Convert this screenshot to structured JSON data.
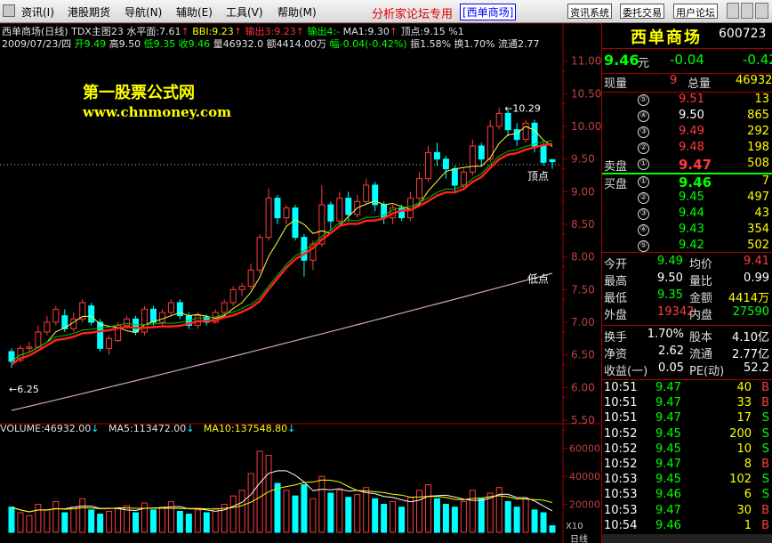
{
  "menubar": {
    "items": [
      "资讯(I)",
      "港股期货",
      "导航(N)",
      "辅助(E)",
      "工具(V)",
      "帮助(M)"
    ],
    "title_text": "分析家论坛专用",
    "title_stock": "[西单商场]",
    "right_buttons": [
      "资讯系统",
      "委托交易",
      "用户论坛"
    ]
  },
  "chart_header": {
    "line1": {
      "name": "西单商场(日线)",
      "indicator": "TDX主图23",
      "level": "水平面:7.61",
      "bbi": "BBI:9.23",
      "out1": "输出3:9.23",
      "out2": "输出4:-",
      "ma1": "MA1:9.30",
      "top": "顶点:9.15",
      "pct": "%1"
    },
    "line2": {
      "date": "2009/07/23/四",
      "open": "开9.49",
      "high": "高9.50",
      "low": "低9.35",
      "close": "收9.46",
      "vol": "量46932.0",
      "amount": "额4414.00万",
      "change": "幅-0.04(-0.42%)",
      "amp": "振1.58%",
      "turnover": "换1.70%",
      "float": "流通2.77"
    }
  },
  "watermark": {
    "line1": "第一股票公式网",
    "line2": "www.chnmoney.com"
  },
  "annotations": {
    "high_label": "10.29",
    "low_label": "6.25",
    "top_point": "顶点",
    "low_point": "低点"
  },
  "volume_header": {
    "vol": "VOLUME:46932.00",
    "ma5": "MA5:113472.00",
    "ma10": "MA10:137548.80"
  },
  "colors": {
    "up": "#ff3c3c",
    "down": "#00ffff",
    "ma_red": "#ff2020",
    "ma_green": "#00c000",
    "ma_long": "#d0a0d0",
    "grid_red": "#a00000"
  },
  "chart_data": {
    "type": "candlestick",
    "title": "西单商场(日线)",
    "ylim": [
      5.5,
      11.2
    ],
    "yticks": [
      "11.00",
      "10.50",
      "10.00",
      "9.50",
      "9.00",
      "8.50",
      "8.00",
      "7.50",
      "7.00",
      "6.50",
      "6.00",
      "5.50"
    ],
    "vol_ylim": [
      0,
      70000
    ],
    "vol_yticks": [
      "60000",
      "40000",
      "20000"
    ],
    "vol_scale": "X10",
    "candles": [
      [
        6.55,
        6.4,
        6.6,
        6.3
      ],
      [
        6.42,
        6.6,
        6.65,
        6.38
      ],
      [
        6.6,
        6.62,
        6.7,
        6.55
      ],
      [
        6.62,
        6.85,
        6.95,
        6.6
      ],
      [
        6.85,
        7.0,
        7.1,
        6.8
      ],
      [
        7.0,
        7.2,
        7.25,
        6.95
      ],
      [
        7.1,
        6.9,
        7.2,
        6.85
      ],
      [
        6.9,
        7.05,
        7.15,
        6.85
      ],
      [
        7.05,
        7.3,
        7.35,
        7.0
      ],
      [
        7.25,
        7.0,
        7.3,
        6.95
      ],
      [
        7.0,
        6.6,
        7.05,
        6.55
      ],
      [
        6.6,
        6.75,
        6.8,
        6.5
      ],
      [
        6.72,
        6.95,
        7.0,
        6.7
      ],
      [
        6.95,
        7.05,
        7.1,
        6.9
      ],
      [
        7.05,
        6.85,
        7.1,
        6.8
      ],
      [
        6.85,
        7.2,
        7.25,
        6.8
      ],
      [
        7.2,
        7.0,
        7.25,
        6.95
      ],
      [
        7.0,
        7.15,
        7.2,
        6.95
      ],
      [
        7.15,
        7.3,
        7.35,
        7.1
      ],
      [
        7.3,
        7.1,
        7.35,
        7.05
      ],
      [
        7.1,
        6.95,
        7.15,
        6.9
      ],
      [
        6.95,
        7.1,
        7.15,
        6.9
      ],
      [
        7.08,
        7.0,
        7.12,
        6.95
      ],
      [
        7.0,
        7.15,
        7.2,
        6.98
      ],
      [
        7.15,
        7.3,
        7.35,
        7.1
      ],
      [
        7.3,
        7.5,
        7.55,
        7.25
      ],
      [
        7.5,
        7.55,
        7.6,
        7.4
      ],
      [
        7.55,
        7.8,
        7.9,
        7.5
      ],
      [
        7.8,
        8.3,
        8.35,
        7.75
      ],
      [
        8.3,
        8.9,
        9.05,
        8.25
      ],
      [
        8.9,
        8.6,
        8.95,
        8.5
      ],
      [
        8.6,
        8.75,
        8.8,
        8.5
      ],
      [
        8.75,
        8.3,
        8.8,
        8.25
      ],
      [
        8.3,
        7.95,
        8.35,
        7.7
      ],
      [
        7.95,
        8.2,
        8.25,
        7.8
      ],
      [
        8.2,
        8.8,
        9.1,
        8.15
      ],
      [
        8.8,
        8.55,
        8.85,
        8.4
      ],
      [
        8.55,
        8.9,
        9.0,
        8.5
      ],
      [
        8.9,
        8.65,
        9.0,
        8.55
      ],
      [
        8.65,
        8.85,
        8.95,
        8.6
      ],
      [
        8.85,
        9.1,
        9.2,
        8.8
      ],
      [
        9.1,
        8.8,
        9.15,
        8.7
      ],
      [
        8.8,
        8.6,
        8.85,
        8.5
      ],
      [
        8.6,
        8.75,
        8.8,
        8.5
      ],
      [
        8.75,
        8.6,
        8.8,
        8.55
      ],
      [
        8.6,
        8.9,
        9.0,
        8.55
      ],
      [
        8.9,
        9.2,
        9.3,
        8.85
      ],
      [
        9.2,
        9.6,
        9.7,
        9.15
      ],
      [
        9.6,
        9.5,
        9.75,
        9.4
      ],
      [
        9.5,
        9.35,
        9.55,
        9.2
      ],
      [
        9.35,
        9.1,
        9.4,
        9.0
      ],
      [
        9.1,
        9.3,
        9.35,
        9.05
      ],
      [
        9.3,
        9.7,
        9.8,
        9.25
      ],
      [
        9.7,
        9.5,
        9.75,
        9.4
      ],
      [
        9.5,
        10.0,
        10.1,
        9.45
      ],
      [
        10.0,
        10.2,
        10.29,
        9.95
      ],
      [
        10.2,
        9.95,
        10.25,
        9.85
      ],
      [
        9.95,
        9.8,
        10.05,
        9.7
      ],
      [
        9.8,
        10.05,
        10.1,
        9.75
      ],
      [
        10.05,
        9.7,
        10.1,
        9.6
      ],
      [
        9.7,
        9.45,
        9.75,
        9.4
      ],
      [
        9.49,
        9.46,
        9.5,
        9.35
      ]
    ],
    "volumes": [
      18000,
      14000,
      12000,
      20000,
      16000,
      22000,
      14000,
      18000,
      24000,
      16000,
      13000,
      15000,
      17000,
      19000,
      14000,
      21000,
      16000,
      18000,
      22000,
      15000,
      13000,
      16000,
      14000,
      17000,
      20000,
      26000,
      30000,
      42000,
      58000,
      55000,
      35000,
      30000,
      26000,
      34000,
      24000,
      40000,
      28000,
      30000,
      25000,
      27000,
      32000,
      24000,
      20000,
      22000,
      18000,
      25000,
      30000,
      34000,
      24000,
      20000,
      18000,
      22000,
      30000,
      24000,
      28000,
      32000,
      22000,
      18000,
      24000,
      16000,
      14000,
      4693
    ],
    "ma_series": [
      "MA1",
      "BBI",
      "水平面"
    ]
  },
  "panel": {
    "name": "西单商场",
    "code": "600723",
    "price": "9.46",
    "unit": "元",
    "change": "-0.04",
    "change_pct": "-0.42",
    "now_vol_label": "现量",
    "now_vol": "9",
    "total_label": "总量",
    "total": "46932",
    "sell_label": "卖盘",
    "buy_label": "买盘",
    "asks": [
      {
        "lvl": "⑤",
        "price": "9.51",
        "vol": "13"
      },
      {
        "lvl": "④",
        "price": "9.50",
        "vol": "865"
      },
      {
        "lvl": "③",
        "price": "9.49",
        "vol": "292"
      },
      {
        "lvl": "②",
        "price": "9.48",
        "vol": "198"
      },
      {
        "lvl": "①",
        "price": "9.47",
        "vol": "508"
      }
    ],
    "bids": [
      {
        "lvl": "①",
        "price": "9.46",
        "vol": "7"
      },
      {
        "lvl": "②",
        "price": "9.45",
        "vol": "497"
      },
      {
        "lvl": "③",
        "price": "9.44",
        "vol": "43"
      },
      {
        "lvl": "④",
        "price": "9.43",
        "vol": "354"
      },
      {
        "lvl": "⑤",
        "price": "9.42",
        "vol": "502"
      }
    ],
    "stats": [
      {
        "l1": "今开",
        "v1": "9.49",
        "l2": "均价",
        "v2": "9.41"
      },
      {
        "l1": "最高",
        "v1": "9.50",
        "l2": "量比",
        "v2": "0.99"
      },
      {
        "l1": "最低",
        "v1": "9.35",
        "l2": "金额",
        "v2": "4414万"
      },
      {
        "l1": "外盘",
        "v1": "19342",
        "l2": "内盘",
        "v2": "27590"
      }
    ],
    "fin": [
      {
        "l1": "换手",
        "v1": "1.70%",
        "l2": "股本",
        "v2": "4.10亿"
      },
      {
        "l1": "净资",
        "v1": "2.62",
        "l2": "流通",
        "v2": "2.77亿"
      },
      {
        "l1": "收益(一)",
        "v1": "0.05",
        "l2": "PE(动)",
        "v2": "52.2"
      }
    ],
    "ticks": [
      {
        "t": "10:51",
        "p": "9.47",
        "v": "40",
        "s": "B"
      },
      {
        "t": "10:51",
        "p": "9.47",
        "v": "33",
        "s": "B"
      },
      {
        "t": "10:51",
        "p": "9.47",
        "v": "17",
        "s": "S"
      },
      {
        "t": "10:52",
        "p": "9.45",
        "v": "200",
        "s": "S"
      },
      {
        "t": "10:52",
        "p": "9.45",
        "v": "10",
        "s": "S"
      },
      {
        "t": "10:52",
        "p": "9.47",
        "v": "8",
        "s": "B"
      },
      {
        "t": "10:53",
        "p": "9.45",
        "v": "102",
        "s": "S"
      },
      {
        "t": "10:53",
        "p": "9.46",
        "v": "6",
        "s": "S"
      },
      {
        "t": "10:53",
        "p": "9.47",
        "v": "30",
        "s": "B"
      },
      {
        "t": "10:54",
        "p": "9.46",
        "v": "1",
        "s": "B"
      }
    ],
    "bottom_tab": "日线"
  }
}
